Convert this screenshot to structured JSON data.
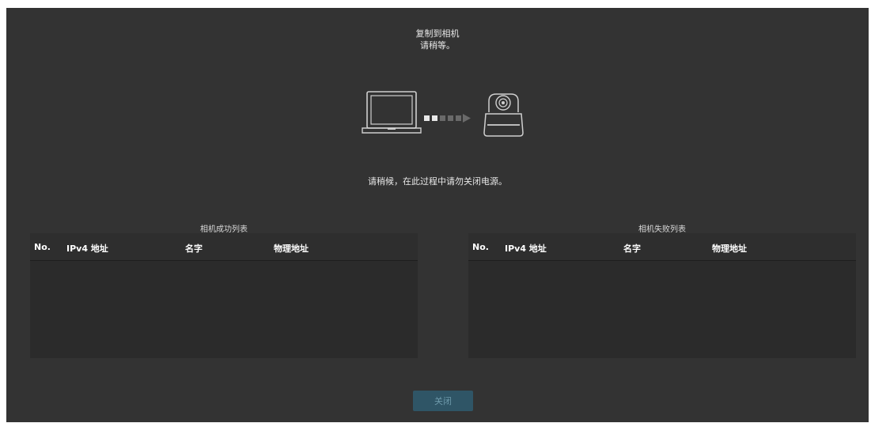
{
  "dialog": {
    "title_line1": "复制到相机",
    "title_line2": "请稍等。",
    "wait_message": "请稍候，在此过程中请勿关闭电源。",
    "icons": {
      "source": "laptop-icon",
      "transfer": "transfer-arrow-icon",
      "target": "ptz-camera-icon"
    }
  },
  "success_table": {
    "caption": "相机成功列表",
    "columns": [
      "No.",
      "IPv4 地址",
      "名字",
      "物理地址"
    ],
    "rows": []
  },
  "fail_table": {
    "caption": "相机失败列表",
    "columns": [
      "No.",
      "IPv4 地址",
      "名字",
      "物理地址"
    ],
    "rows": []
  },
  "buttons": {
    "close_label": "关闭"
  },
  "colors": {
    "background": "#333333",
    "table_background": "#2b2b2b",
    "button_background": "#2f5566",
    "button_text": "#6e9aab"
  }
}
